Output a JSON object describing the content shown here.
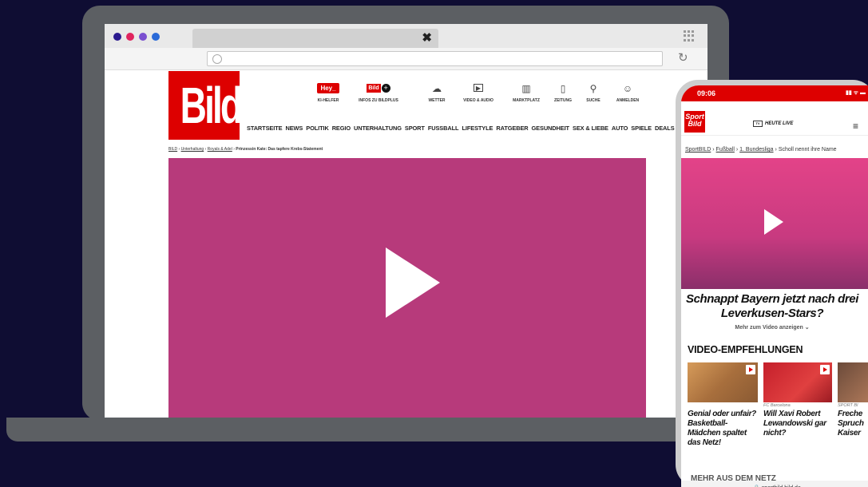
{
  "browser": {
    "dot_colors": [
      "#2b1a8f",
      "#e0245e",
      "#7a4fd0",
      "#2a6ad8"
    ],
    "tab_close_glyph": "✖",
    "reload_glyph": "↻"
  },
  "bild": {
    "logo": "Bild",
    "top_icons": [
      {
        "name": "ki-helfer",
        "badge": "Hey_",
        "label": "KI-HELFER"
      },
      {
        "name": "bildplus",
        "badge": "Bild",
        "label": "INFOS ZU BILDPLUS"
      },
      {
        "name": "wetter",
        "glyph": "☁",
        "label": "WETTER"
      },
      {
        "name": "video-audio",
        "glyph": "▶",
        "label": "VIDEO & AUDIO"
      },
      {
        "name": "marktplatz",
        "glyph": "▥",
        "label": "MARKTPLATZ"
      },
      {
        "name": "zeitung",
        "glyph": "▯",
        "label": "ZEITUNG"
      },
      {
        "name": "suche",
        "glyph": "⚲",
        "label": "SUCHE"
      },
      {
        "name": "anmelden",
        "glyph": "☺",
        "label": "ANMELDEN"
      }
    ],
    "nav": [
      "STARTSEITE",
      "NEWS",
      "POLITIK",
      "REGIO",
      "UNTERHALTUNG",
      "SPORT",
      "FUSSBALL",
      "LIFESTYLE",
      "RATGEBER",
      "GESUNDHEIT",
      "SEX & LIEBE",
      "AUTO",
      "SPIELE",
      "DEALS"
    ],
    "breadcrumb": [
      "BILD",
      "Unterhaltung",
      "Royals & Adel",
      "Prinzessin Kate: Das tapfere Krebs-Statement"
    ],
    "breadcrumb_sep": "›",
    "video_color": "#b73a7b"
  },
  "phone": {
    "time": "09:06",
    "signal": "▮▮ ᯤ ▬",
    "logo": "Sport Bild",
    "heute_live": "HEUTE LIVE",
    "heute_tv": "TV",
    "menu_glyph": "≡",
    "breadcrumb": [
      "SportBILD",
      "Fußball",
      "1. Bundesliga",
      "Scholl nennt ihre Name"
    ],
    "breadcrumb_sep": "›",
    "headline": "Schnappt Bayern jetzt nach drei Leverkusen-Stars?",
    "more_video": "Mehr zum Video anzeigen ⌄",
    "recommendations_title": "VIDEO-EMPFEHLUNGEN",
    "cards": [
      {
        "kicker": "",
        "title": "Genial oder unfair? Basketball-Mädchen spaltet das Netz!"
      },
      {
        "kicker": "FC Barcelona",
        "title": "Will Xavi Robert Lewandowski gar nicht?"
      },
      {
        "kicker": "SPORT BI",
        "title": "Freche Spruch Kaiser"
      }
    ],
    "more_net": "MEHR AUS DEM NETZ",
    "url": "🔒 sportbild.bild.de"
  }
}
